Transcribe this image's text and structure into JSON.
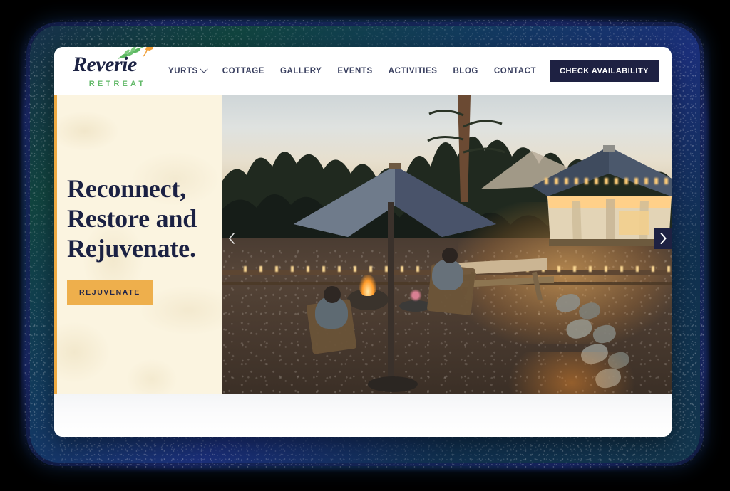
{
  "brand": {
    "name": "Reverie",
    "tagline": "RETREAT",
    "logo_icon": "leaf-branch-bird-icon",
    "colors": {
      "navy": "#1e2142",
      "green": "#63b969",
      "amber": "#eeaf4c",
      "cream": "#fbf4e0"
    }
  },
  "nav": {
    "items": [
      {
        "label": "YURTS",
        "has_dropdown": true,
        "icon": "chevron-down-icon"
      },
      {
        "label": "COTTAGE",
        "has_dropdown": false
      },
      {
        "label": "GALLERY",
        "has_dropdown": false
      },
      {
        "label": "EVENTS",
        "has_dropdown": false
      },
      {
        "label": "ACTIVITIES",
        "has_dropdown": false
      },
      {
        "label": "BLOG",
        "has_dropdown": false
      },
      {
        "label": "CONTACT",
        "has_dropdown": false
      }
    ],
    "cta_label": "CHECK AVAILABILITY"
  },
  "hero": {
    "title_line1": "Reconnect,",
    "title_line2": "Restore and",
    "title_line3": "Rejuvenate.",
    "button_label": "REJUVENATE",
    "photo_alt": "Glamping yurt at dusk with string lights, patio umbrella, fire pit and two guests in Adirondack chairs",
    "carousel": {
      "prev_icon": "chevron-left-icon",
      "next_icon": "chevron-right-icon"
    }
  }
}
